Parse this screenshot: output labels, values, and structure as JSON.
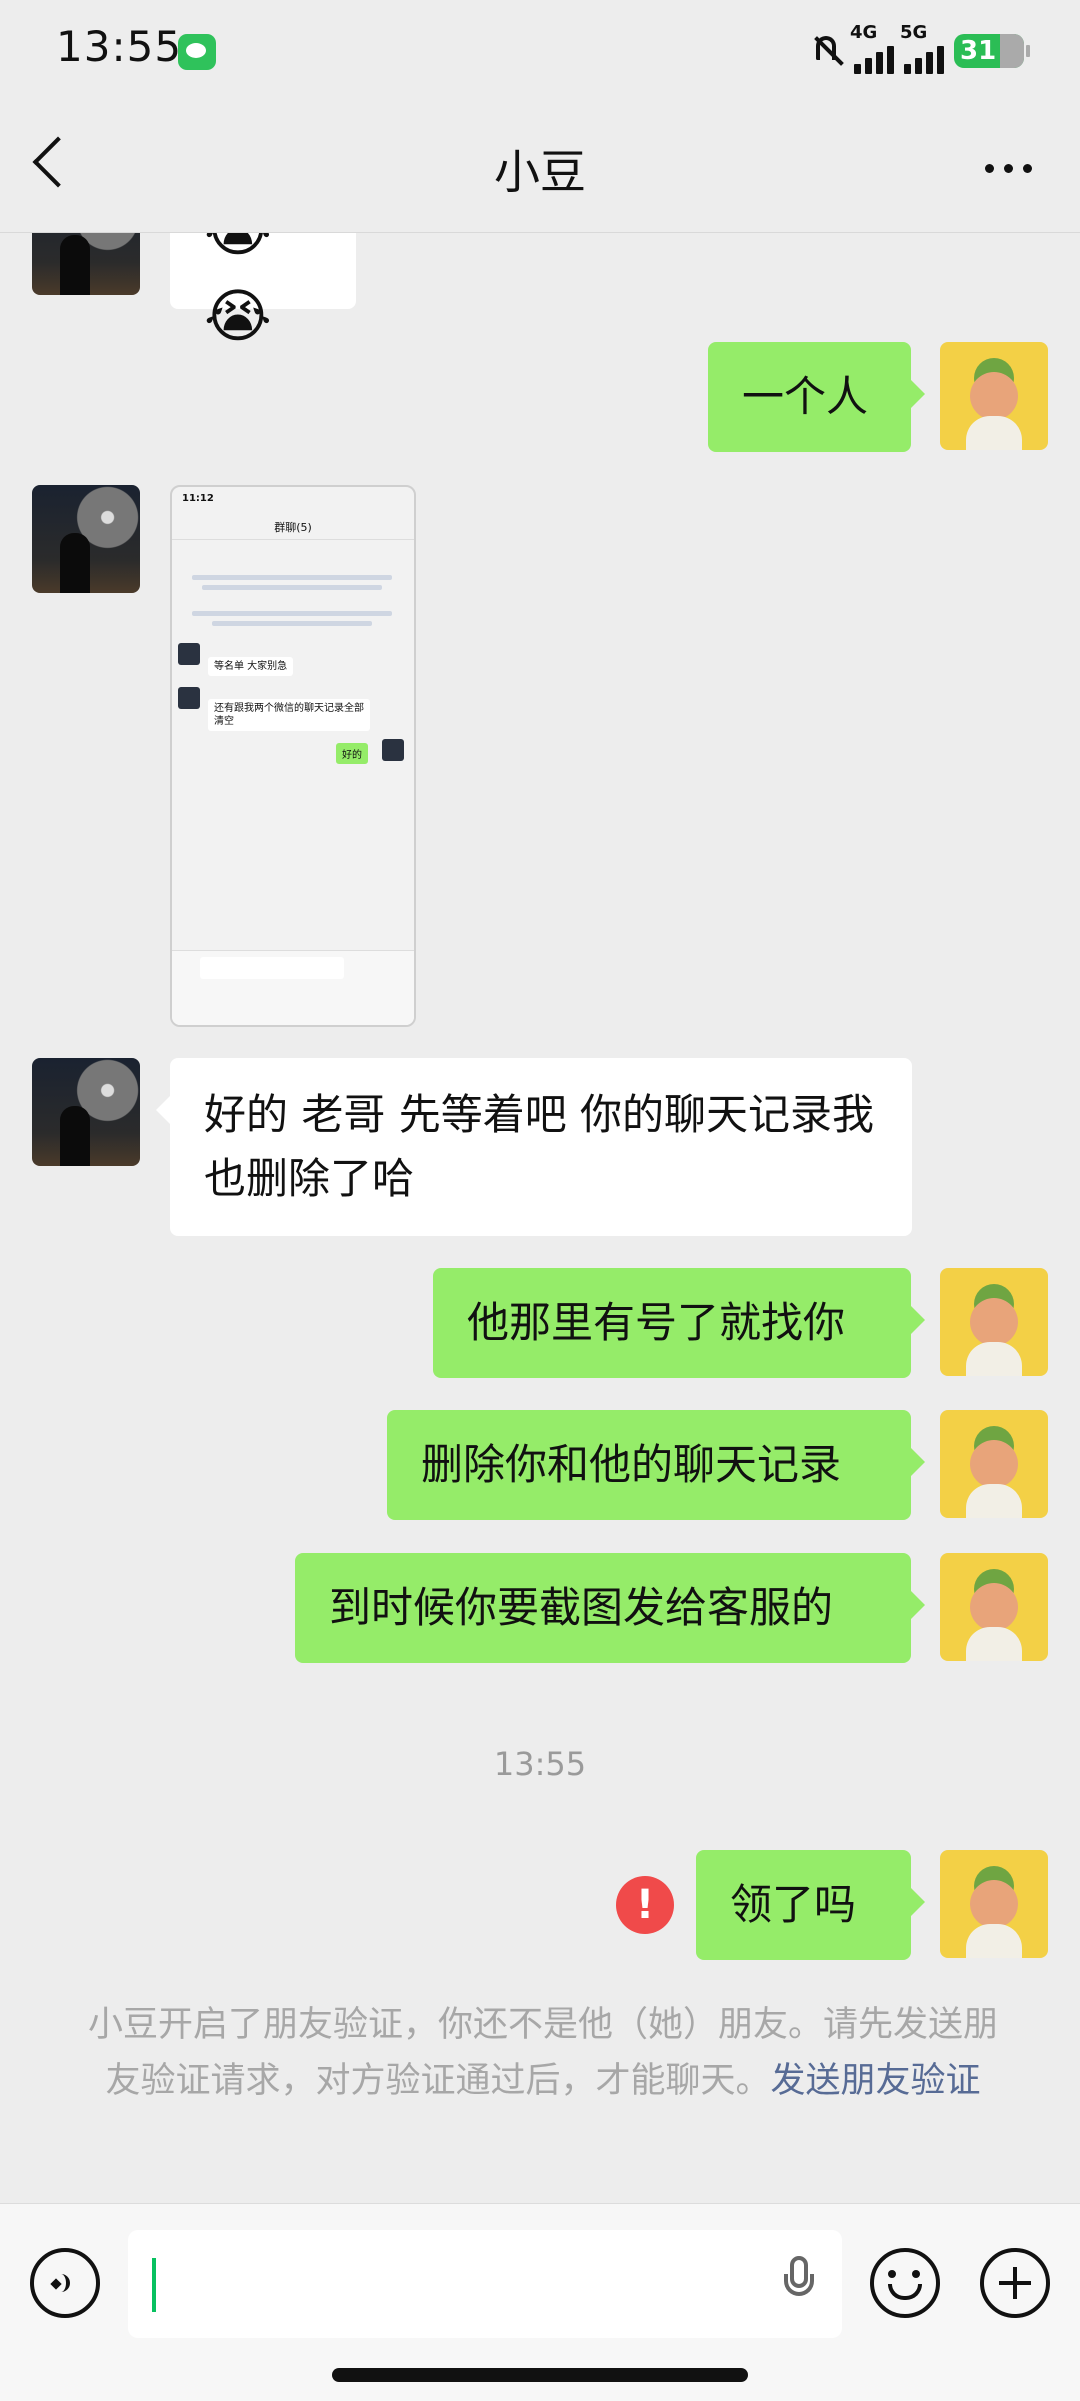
{
  "status_bar": {
    "time": "13:55",
    "net1": "4G",
    "net2": "5G",
    "battery": "31"
  },
  "header": {
    "title": "小豆"
  },
  "messages": {
    "m1_emoji": "😭😭",
    "m2": "一个人",
    "m4": "好的 老哥 先等着吧 你的聊天记录我也删除了哈",
    "m5": "他那里有号了就找你",
    "m6": "删除你和他的聊天记录",
    "m7": "到时候你要截图发给客服的",
    "m8": "领了吗"
  },
  "screenshot_preview": {
    "time": "11:12",
    "title": "群聊(5)",
    "msg1": "等名单 大家别急",
    "msg2": "还有跟我两个微信的聊天记录全部清空",
    "reply": "好的"
  },
  "timestamp": "13:55",
  "error_mark": "!",
  "notice": {
    "text": "小豆开启了朋友验证，你还不是他（她）朋友。请先发送朋友验证请求，对方验证通过后，才能聊天。",
    "link": "发送朋友验证"
  },
  "input": {
    "value": ""
  }
}
